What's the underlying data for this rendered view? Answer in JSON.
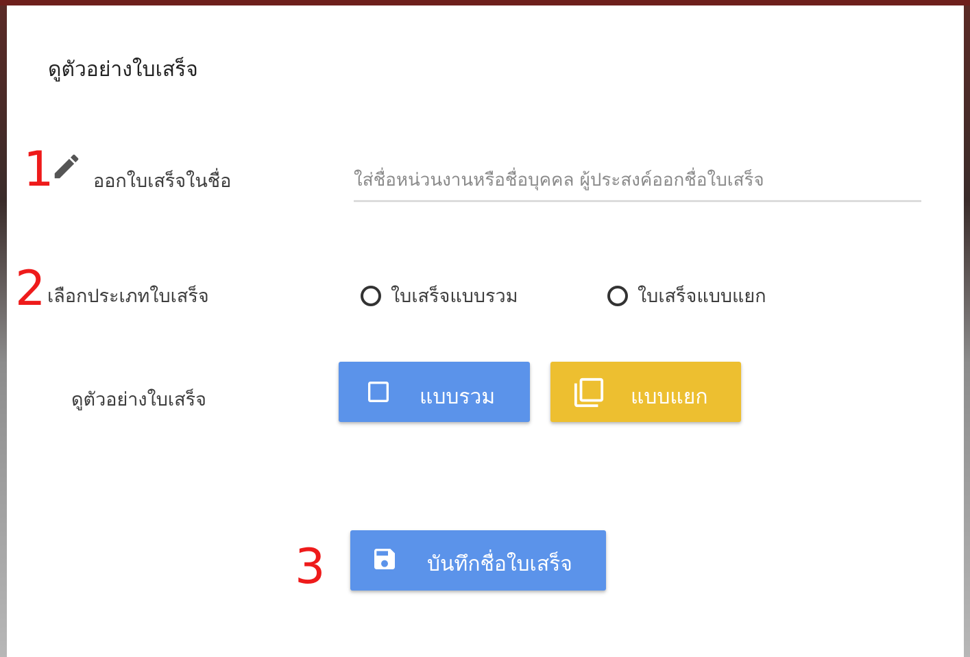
{
  "dialog": {
    "title": "ดูตัวอย่างใบเสร็จ"
  },
  "steps": {
    "step1": "1",
    "step2": "2",
    "step3": "3"
  },
  "name_row": {
    "icon": "pencil-icon",
    "label": "ออกใบเสร็จในชื่อ",
    "input_value": "",
    "input_placeholder": "ใส่ชื่อหน่วนงานหรือชื่อบุคคล ผู้ประสงค์ออกชื่อใบเสร็จ"
  },
  "type_row": {
    "label": "เลือกประเภทใบเสร็จ",
    "options": [
      {
        "label": "ใบเสร็จแบบรวม",
        "selected": false
      },
      {
        "label": "ใบเสร็จแบบแยก",
        "selected": false
      }
    ]
  },
  "preview_row": {
    "label": "ดูตัวอย่างใบเสร็จ",
    "combined_button": {
      "label": "แบบรวม",
      "icon": "square-outline-icon",
      "color": "#5b93ea"
    },
    "separate_button": {
      "label": "แบบแยก",
      "icon": "copy-icon",
      "color": "#edbf30"
    }
  },
  "save_button": {
    "label": "บันทึกชื่อใบเสร็จ",
    "icon": "save-icon",
    "color": "#5b93ea"
  },
  "colors": {
    "step_number": "#ee1b1b",
    "primary": "#5b93ea",
    "warning": "#edbf30"
  }
}
